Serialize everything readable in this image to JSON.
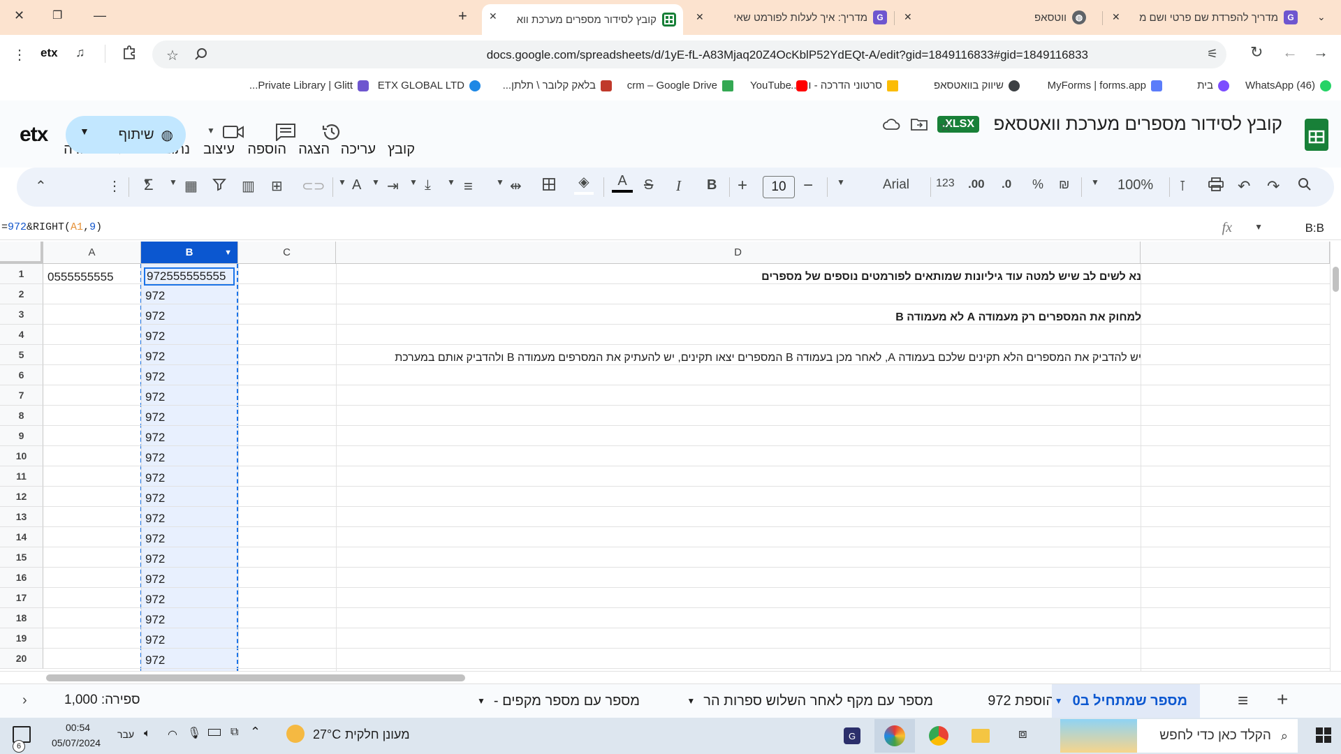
{
  "browser": {
    "tabs": [
      {
        "title": "מדריך להפרדת שם פרטי ושם מ",
        "favicon": "G",
        "favcolor": "#6e56cf"
      },
      {
        "title": "ווטסאפ",
        "favicon": "globe",
        "favcolor": "#5f6368"
      },
      {
        "title": "מדריך: איך לעלות לפורמט שאי",
        "favicon": "G",
        "favcolor": "#6e56cf"
      },
      {
        "title": "קובץ לסידור מספרים מערכת ווא",
        "favicon": "sheets",
        "favcolor": "#188038"
      }
    ],
    "url": "docs.google.com/spreadsheets/d/1yE-fL-A83Mjaq20Z4OcKblP52YdEQt-A/edit?gid=1849116833#gid=1849116833",
    "bookmarks": [
      {
        "label": "(46) WhatsApp",
        "color": "#25d366"
      },
      {
        "label": "בית",
        "color": "#7c4dff"
      },
      {
        "label": "MyForms | forms.app",
        "color": "#5b7cfa"
      },
      {
        "label": "שיווק בוואטסאפ",
        "color": "#3c4043"
      },
      {
        "label": "סרטוני הדרכה - ווב ...",
        "color": "#fbbc04"
      },
      {
        "label": "YouTube",
        "color": "#ff0000"
      },
      {
        "label": "crm – Google Drive",
        "color": "#34a853"
      },
      {
        "label": "בלאק קלובר \\ תלתן...",
        "color": "#c0392b"
      },
      {
        "label": "ETX GLOBAL LTD",
        "color": "#1e88e5"
      },
      {
        "label": "Private Library | Glitt...",
        "color": "#6e56cf"
      }
    ]
  },
  "docs": {
    "title": "קובץ לסידור מספרים מערכת וואטסאפ",
    "badge": ".XLSX",
    "menus": [
      "קובץ",
      "עריכה",
      "הצגה",
      "הוספה",
      "עיצוב",
      "נתונים",
      "כלים",
      "עזרה"
    ],
    "share_label": "שיתוף",
    "logo": "etx"
  },
  "toolbar": {
    "zoom": "100%",
    "font": "Arial",
    "font_size": "10",
    "currency": "₪",
    "percent": "%",
    "dec_minus": ".0",
    "dec_plus": ".00",
    "numfmt": "123"
  },
  "formula": {
    "namebox": "B:B",
    "parts": [
      "=",
      "972",
      "&RIGHT(",
      "A1",
      ",",
      "9",
      ")"
    ]
  },
  "grid": {
    "columns": [
      "A",
      "B",
      "C",
      "D"
    ],
    "rows": [
      "1",
      "2",
      "3",
      "4",
      "5",
      "6",
      "7",
      "8",
      "9",
      "10",
      "11",
      "12",
      "13",
      "14",
      "15",
      "16",
      "17",
      "18",
      "19",
      "20"
    ],
    "a1": "0555555555",
    "b1": "972555555555",
    "b_rest": "972",
    "d1": "נא לשים לב שיש למטה עוד גיליונות שמותאים לפורמטים נוספים של מספרים",
    "d3": "למחוק את המספרים רק מעמודה A לא מעמודה B",
    "d5": "יש להדביק את המספרים הלא תקינים שלכם בעמודה A, לאחר מכן בעמודה B המספרים יצאו תקינים, יש להעתיק את המסרפים מעמודה B ולהדביק אותם במערכת"
  },
  "sheets": {
    "tabs": [
      "מספר שמתחיל ב0",
      "הוספת 972",
      "מספר עם מקף לאחר השלוש ספרות הר",
      "מספר עם מספר מקפים -"
    ],
    "count": "ספירה: 1,000"
  },
  "taskbar": {
    "search": "הקלד כאן כדי לחפש",
    "weather_text": "מעונן חלקית",
    "temp": "27°C",
    "lang": "עבר",
    "time": "00:54",
    "date": "05/07/2024",
    "notif": "6"
  }
}
